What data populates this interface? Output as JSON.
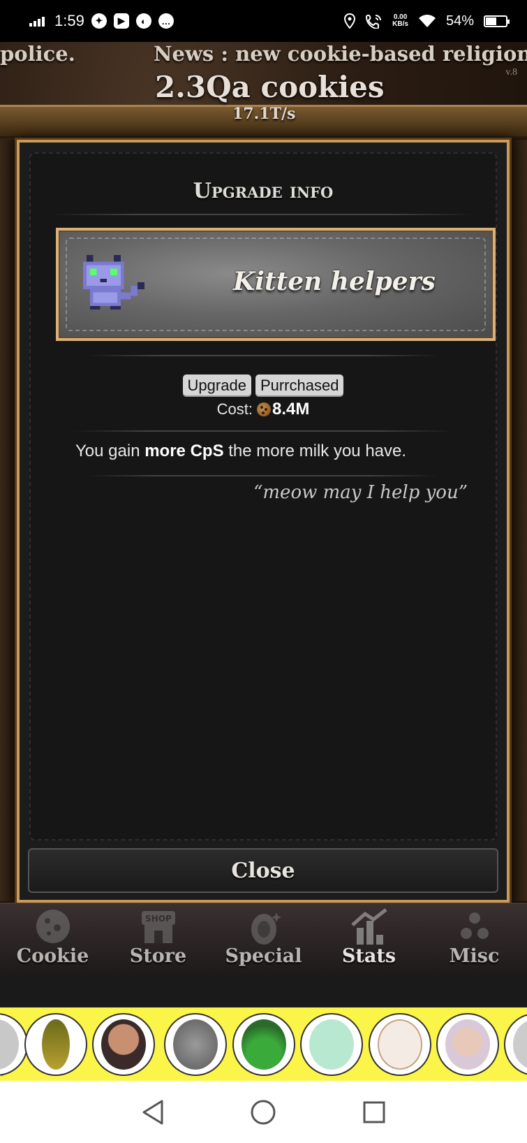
{
  "status_bar": {
    "time": "1:59",
    "net_speed_value": "0.00",
    "net_speed_unit": "KB/s",
    "battery_percent": "54%",
    "battery_level": 0.54,
    "icons": [
      "signal-icon",
      "game-controller-icon",
      "youtube-icon",
      "app-icon",
      "chat-icon",
      "location-icon",
      "wifi-call-icon",
      "wifi-icon",
      "battery-icon"
    ]
  },
  "game": {
    "news_fragment_left": "police.",
    "news_headline": "News : new cookie-based religion",
    "version": "v.8",
    "cookie_count": "2.3Qa cookies",
    "cps": "17.1T/s"
  },
  "modal": {
    "title": "Upgrade info",
    "upgrade_name": "Kitten helpers",
    "upgrade_icon": "kitten-icon",
    "tags": [
      "Upgrade",
      "Purrchased"
    ],
    "cost_label": "Cost:",
    "cost_value": "8.4M",
    "description_pre": "You gain ",
    "description_bold": "more CpS",
    "description_post": " the more milk you have.",
    "quote": "“meow may I help you”",
    "close_label": "Close"
  },
  "tabs": [
    {
      "label": "Cookie",
      "icon": "cookie-icon"
    },
    {
      "label": "Store",
      "icon": "shop-icon",
      "icon_text": "SHOP"
    },
    {
      "label": "Special",
      "icon": "egg-icon"
    },
    {
      "label": "Stats",
      "icon": "stats-icon"
    },
    {
      "label": "Misc",
      "icon": "dots-icon"
    }
  ],
  "ad": {
    "icon": "adchoices-icon",
    "stickers": [
      "pickle-sticker",
      "bearded-man-sticker",
      "gray-cat-sticker",
      "broccoli-sticker",
      "green-face-sticker",
      "white-cat-sticker",
      "blonde-woman-sticker"
    ]
  },
  "navbar": {
    "buttons": [
      "back-icon",
      "home-icon",
      "recents-icon"
    ]
  },
  "colors": {
    "frame_gold": "#c99a5a",
    "modal_bg": "#1c1c1c",
    "ad_yellow": "#fbf54a"
  }
}
